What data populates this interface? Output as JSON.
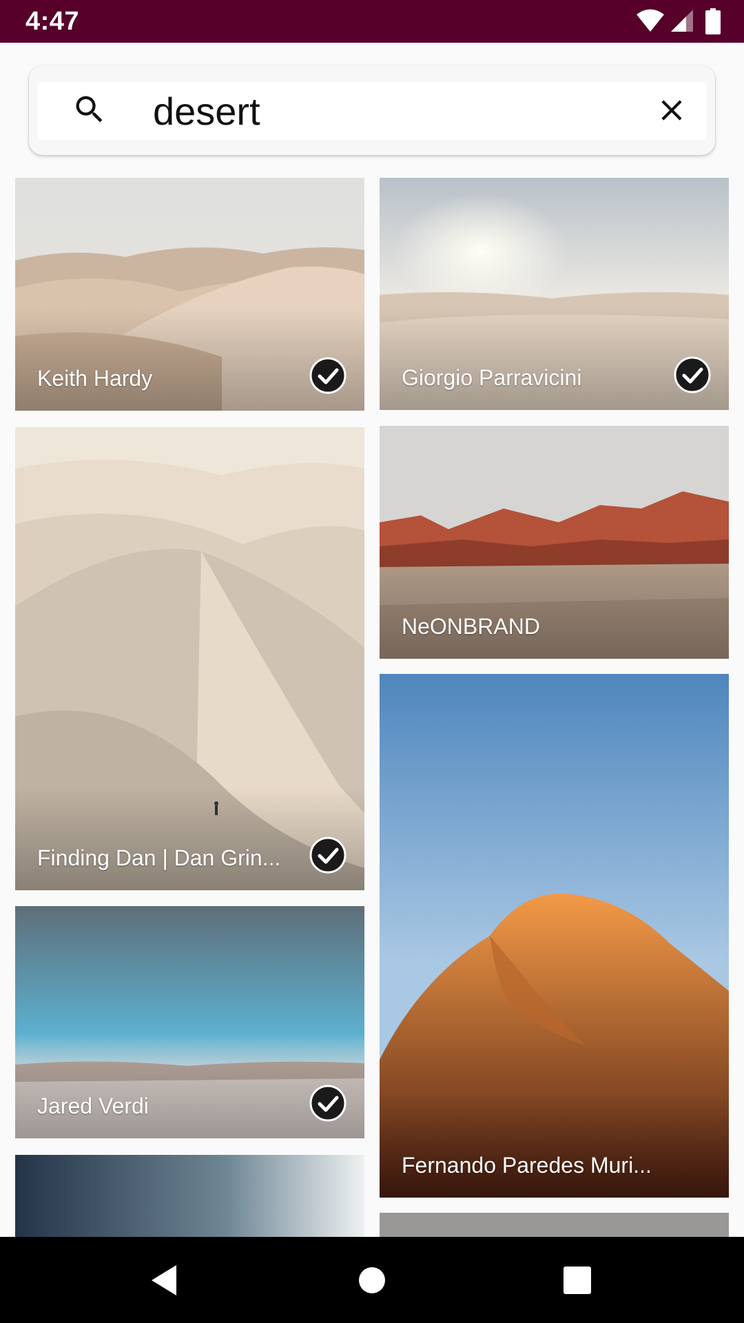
{
  "status_bar": {
    "time": "4:47",
    "icons": [
      "wifi-icon",
      "cell-signal-icon",
      "battery-icon"
    ],
    "background_color": "#56002a"
  },
  "search": {
    "query": "desert",
    "icons": {
      "search": "search-icon",
      "clear": "close-icon"
    }
  },
  "photos": [
    {
      "author": "Keith Hardy",
      "selected": true,
      "scene": "pale sand dunes"
    },
    {
      "author": "Giorgio Parravicini",
      "selected": true,
      "scene": "sunlit rippled dunes"
    },
    {
      "author": "Finding Dan | Dan Grin...",
      "selected": true,
      "scene": "tall dune with hiker"
    },
    {
      "author": "NeONBRAND",
      "selected": false,
      "scene": "red rock ridge"
    },
    {
      "author": "Jared Verdi",
      "selected": true,
      "scene": "salt flats under blue sky"
    },
    {
      "author": "Fernando Paredes Muri...",
      "selected": false,
      "scene": "orange dune, blue sky"
    }
  ],
  "navigation": {
    "buttons": [
      "back-icon",
      "home-icon",
      "recents-icon"
    ]
  }
}
